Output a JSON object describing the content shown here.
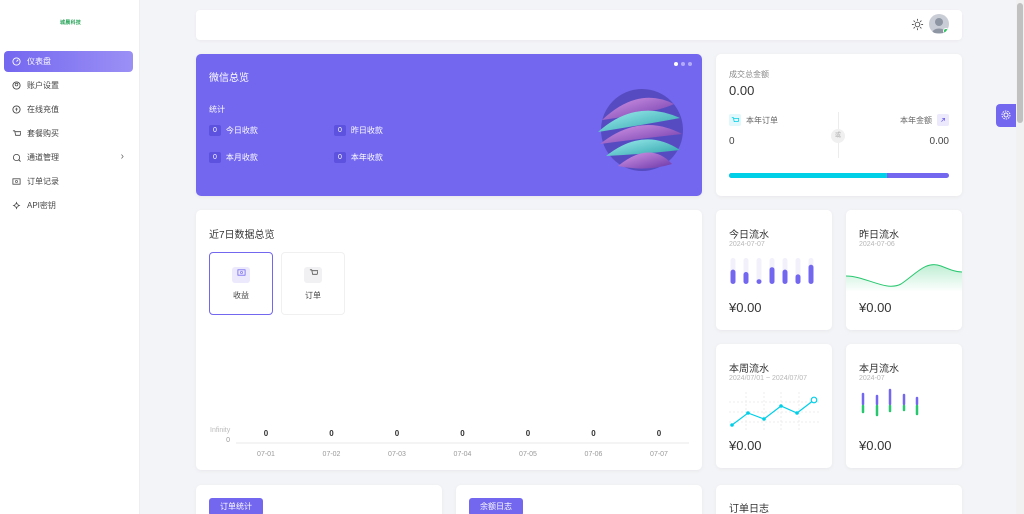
{
  "app": {
    "logo_text": "城晨科技"
  },
  "sidebar": {
    "items": [
      {
        "label": "仪表盘",
        "icon": "dashboard-icon"
      },
      {
        "label": "账户设置",
        "icon": "user-settings-icon"
      },
      {
        "label": "在线充值",
        "icon": "recharge-icon"
      },
      {
        "label": "套餐购买",
        "icon": "cart-icon"
      },
      {
        "label": "通道管理",
        "icon": "channel-icon"
      },
      {
        "label": "订单记录",
        "icon": "order-record-icon"
      },
      {
        "label": "API密钥",
        "icon": "key-icon"
      }
    ]
  },
  "wechat": {
    "title": "微信总览",
    "subtitle": "统计",
    "stats": [
      {
        "value": "0",
        "label": "今日收款"
      },
      {
        "value": "0",
        "label": "昨日收款"
      },
      {
        "value": "0",
        "label": "本月收款"
      },
      {
        "value": "0",
        "label": "本年收款"
      }
    ]
  },
  "totals": {
    "label": "成交总金额",
    "amount": "0.00",
    "year_orders_label": "本年订单",
    "year_amount_label": "本年金额",
    "year_orders": "0",
    "year_amount": "0.00",
    "vs": "或",
    "progress_orders": 0.72
  },
  "trend": {
    "title": "近7日数据总览",
    "tabs": [
      {
        "label": "收益",
        "icon": "revenue-icon"
      },
      {
        "label": "订单",
        "icon": "cart-icon"
      }
    ]
  },
  "chart_data": {
    "type": "bar",
    "categories": [
      "07-01",
      "07-02",
      "07-03",
      "07-04",
      "07-05",
      "07-06",
      "07-07"
    ],
    "values": [
      0,
      0,
      0,
      0,
      0,
      0,
      0
    ],
    "ylabel": "Infinity",
    "y_zero": "0"
  },
  "flows": [
    {
      "title": "今日流水",
      "date": "2024-07-07",
      "amount": "¥0.00",
      "spark_values": [
        0.6,
        0.5,
        0.2,
        0.7,
        0.6,
        0.4,
        0.8
      ]
    },
    {
      "title": "昨日流水",
      "date": "2024-07-06",
      "amount": "¥0.00",
      "spark": "area"
    },
    {
      "title": "本周流水",
      "date": "2024/07/01 ~ 2024/07/07",
      "amount": "¥0.00",
      "spark": "line"
    },
    {
      "title": "本月流水",
      "date": "2024-07",
      "amount": "¥0.00",
      "spark": "bars"
    }
  ],
  "bottom": {
    "order_stats_btn": "订单统计",
    "balance_btn": "余额日志",
    "order_log_title": "订单日志"
  },
  "colors": {
    "primary": "#7367f0",
    "cyan": "#00cfe8",
    "green": "#28c76f"
  }
}
